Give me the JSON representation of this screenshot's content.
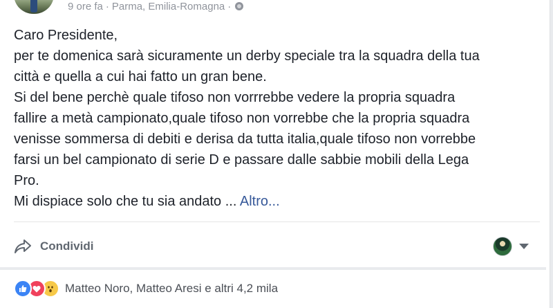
{
  "post": {
    "time": "9 ore fa",
    "separator": "·",
    "location": "Parma, Emilia-Romagna",
    "separator2": "·",
    "privacy_icon": "globe-icon",
    "lines": [
      "Caro Presidente,",
      "per te domenica sarà sicuramente un derby speciale tra la squadra della tua",
      "città e quella a cui hai fatto un gran bene.",
      "Si del bene perchè quale tifoso non vorrrebbe vedere la propria squadra",
      "fallire a metà campionato,quale tifoso non vorrebbe che la propria squadra",
      "venisse sommersa di debiti e derisa da tutta italia,quale tifoso non vorrebbe",
      "farsi un bel campionato di serie D e passare dalle sabbie mobili della Lega",
      "Pro."
    ],
    "last_line_prefix": "Mi dispiace solo che tu sia andato ... ",
    "more_label": "Altro..."
  },
  "actions": {
    "share_label": "Condividi",
    "share_icon": "share-arrow-icon",
    "viewer_icon": "page-avatar-icon",
    "caret_icon": "caret-down-icon"
  },
  "reactions": {
    "icons": [
      "like-icon",
      "love-icon",
      "wow-icon"
    ],
    "names": "Matteo Noro, Matteo Aresi e altri 4,2 mila"
  },
  "colors": {
    "link": "#365899",
    "text": "#1d2129",
    "meta": "#90949c",
    "like": "#3b84f5",
    "love": "#f0415c",
    "wow": "#f7c948"
  }
}
